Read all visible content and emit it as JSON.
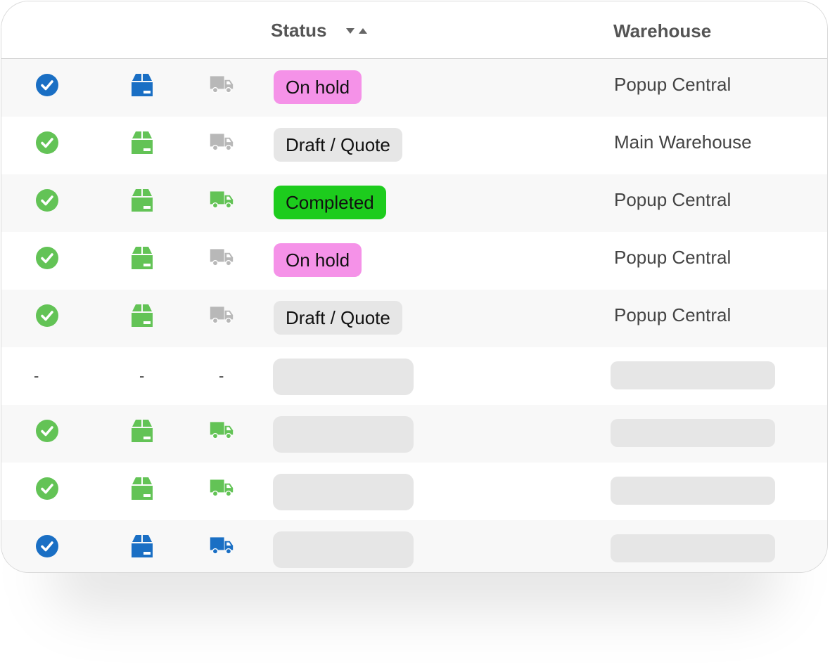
{
  "colors": {
    "blue": "#1a6fc4",
    "green": "#63c356",
    "gray": "#b8b8b8",
    "on_hold_bg": "#f592e8",
    "draft_bg": "#e6e6e6",
    "completed_bg": "#1dcc1d"
  },
  "header": {
    "status_label": "Status",
    "warehouse_label": "Warehouse",
    "sort_icon": "sort-down-up-icon"
  },
  "rows": [
    {
      "check": "blue",
      "box": "blue",
      "truck": "gray",
      "status": "On hold",
      "status_style": "on_hold",
      "warehouse": "Popup Central"
    },
    {
      "check": "green",
      "box": "green",
      "truck": "gray",
      "status": "Draft / Quote",
      "status_style": "draft",
      "warehouse": "Main Warehouse"
    },
    {
      "check": "green",
      "box": "green",
      "truck": "green",
      "status": "Completed",
      "status_style": "completed",
      "warehouse": "Popup Central"
    },
    {
      "check": "green",
      "box": "green",
      "truck": "gray",
      "status": "On hold",
      "status_style": "on_hold",
      "warehouse": "Popup Central"
    },
    {
      "check": "green",
      "box": "green",
      "truck": "gray",
      "status": "Draft / Quote",
      "status_style": "draft",
      "warehouse": "Popup Central"
    },
    {
      "placeholder": true,
      "dash": "-"
    },
    {
      "check": "green",
      "box": "green",
      "truck": "green",
      "loading": true
    },
    {
      "check": "green",
      "box": "green",
      "truck": "green",
      "loading": true
    },
    {
      "check": "blue",
      "box": "blue",
      "truck": "blue",
      "loading": true
    }
  ]
}
